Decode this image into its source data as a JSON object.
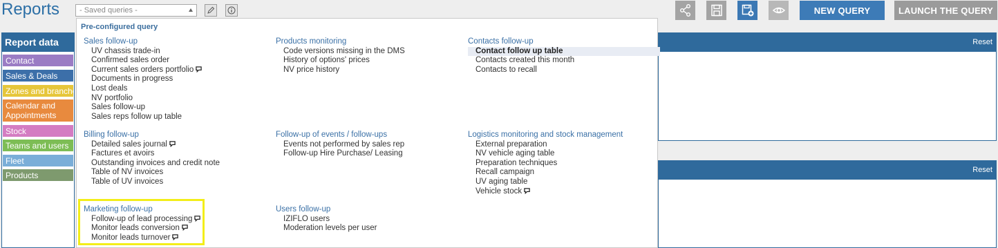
{
  "header": {
    "title": "Reports",
    "saved_placeholder": "- Saved queries -",
    "new_query": "NEW QUERY",
    "launch_query": "LAUNCH THE QUERY"
  },
  "left_panel": {
    "title": "Report data",
    "categories": [
      {
        "label": "Contact",
        "color": "#9b7cc4"
      },
      {
        "label": "Sales & Deals",
        "color": "#3c6fa9"
      },
      {
        "label": "Zones and branches",
        "color": "#e6c63a"
      },
      {
        "label": "Calendar and Appointments",
        "color": "#e88a3e"
      },
      {
        "label": "Stock",
        "color": "#d47cc2"
      },
      {
        "label": "Teams and users",
        "color": "#7dbd55"
      },
      {
        "label": "Fleet",
        "color": "#7aaed8"
      },
      {
        "label": "Products",
        "color": "#7e9a6e"
      }
    ]
  },
  "right_panels": {
    "reset_label": "Reset"
  },
  "dropdown": {
    "title": "Pre-configured query",
    "groups": [
      {
        "title": "Sales follow-up",
        "items": [
          {
            "label": "UV chassis trade-in"
          },
          {
            "label": "Confirmed sales order"
          },
          {
            "label": "Current sales orders portfolio",
            "bubble": true
          },
          {
            "label": "Documents in progress"
          },
          {
            "label": "Lost deals"
          },
          {
            "label": "NV portfolio"
          },
          {
            "label": "Sales follow-up"
          },
          {
            "label": "Sales reps follow up table"
          }
        ]
      },
      {
        "title": "Products monitoring",
        "items": [
          {
            "label": "Code versions missing in the DMS"
          },
          {
            "label": "History of options' prices"
          },
          {
            "label": "NV price history"
          }
        ]
      },
      {
        "title": "Contacts follow-up",
        "items": [
          {
            "label": "Contact follow up table",
            "selected": true
          },
          {
            "label": "Contacts created this month"
          },
          {
            "label": "Contacts to recall"
          }
        ]
      },
      {
        "title": "Billing follow-up",
        "items": [
          {
            "label": "Detailed sales journal",
            "bubble": true
          },
          {
            "label": "Factures et avoirs"
          },
          {
            "label": "Outstanding invoices and credit note"
          },
          {
            "label": "Table of NV invoices"
          },
          {
            "label": "Table of UV invoices"
          }
        ]
      },
      {
        "title": "Follow-up of events / follow-ups",
        "items": [
          {
            "label": "Events not performed by sales rep"
          },
          {
            "label": "Follow-up Hire Purchase/ Leasing"
          }
        ]
      },
      {
        "title": "Logistics monitoring and stock management",
        "items": [
          {
            "label": "External preparation"
          },
          {
            "label": "NV vehicle aging table"
          },
          {
            "label": "Preparation techniques"
          },
          {
            "label": "Recall campaign"
          },
          {
            "label": "UV aging table"
          },
          {
            "label": "Vehicle stock",
            "bubble": true
          }
        ]
      },
      {
        "title": "Marketing follow-up",
        "items": [
          {
            "label": "Follow-up of lead processing",
            "bubble": true
          },
          {
            "label": "Monitor leads conversion",
            "bubble": true
          },
          {
            "label": "Monitor leads turnover",
            "bubble": true
          }
        ]
      },
      {
        "title": "Users follow-up",
        "items": [
          {
            "label": "IZIFLO users"
          },
          {
            "label": "Moderation levels per user"
          }
        ]
      }
    ]
  }
}
